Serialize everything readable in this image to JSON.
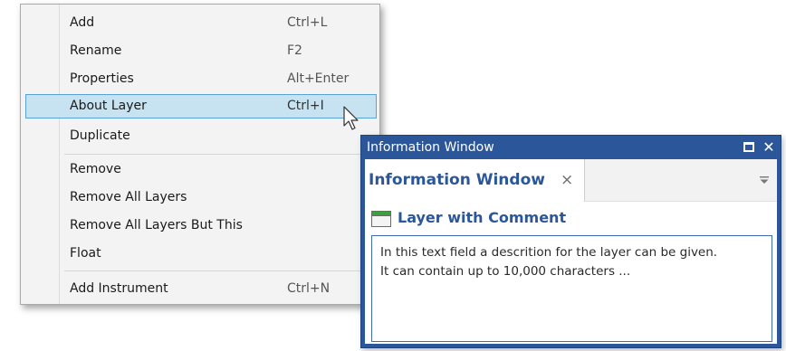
{
  "context_menu": {
    "groups": [
      [
        {
          "label": "Add",
          "shortcut": "Ctrl+L"
        },
        {
          "label": "Rename",
          "shortcut": "F2"
        },
        {
          "label": "Properties",
          "shortcut": "Alt+Enter"
        },
        {
          "label": "About Layer",
          "shortcut": "Ctrl+I",
          "highlighted": true
        },
        {
          "label": "Duplicate",
          "shortcut": ""
        }
      ],
      [
        {
          "label": "Remove",
          "shortcut": ""
        },
        {
          "label": "Remove All Layers",
          "shortcut": ""
        },
        {
          "label": "Remove All Layers But This",
          "shortcut": ""
        },
        {
          "label": "Float",
          "shortcut": ""
        }
      ],
      [
        {
          "label": "Add Instrument",
          "shortcut": "Ctrl+N"
        }
      ]
    ],
    "highlight_color": "#c7e2f1",
    "highlight_border": "#5aa2d5"
  },
  "info_window": {
    "title": "Information Window",
    "tab_label": "Information Window",
    "tab_close_glyph": "×",
    "close_glyph": "✕",
    "layer_title": "Layer with Comment",
    "layer_icon": "layer-icon",
    "description": "In this text field a descrition for the layer can be given.\nIt can contain up to 10,000 characters ...",
    "accent_color": "#2b579a"
  }
}
